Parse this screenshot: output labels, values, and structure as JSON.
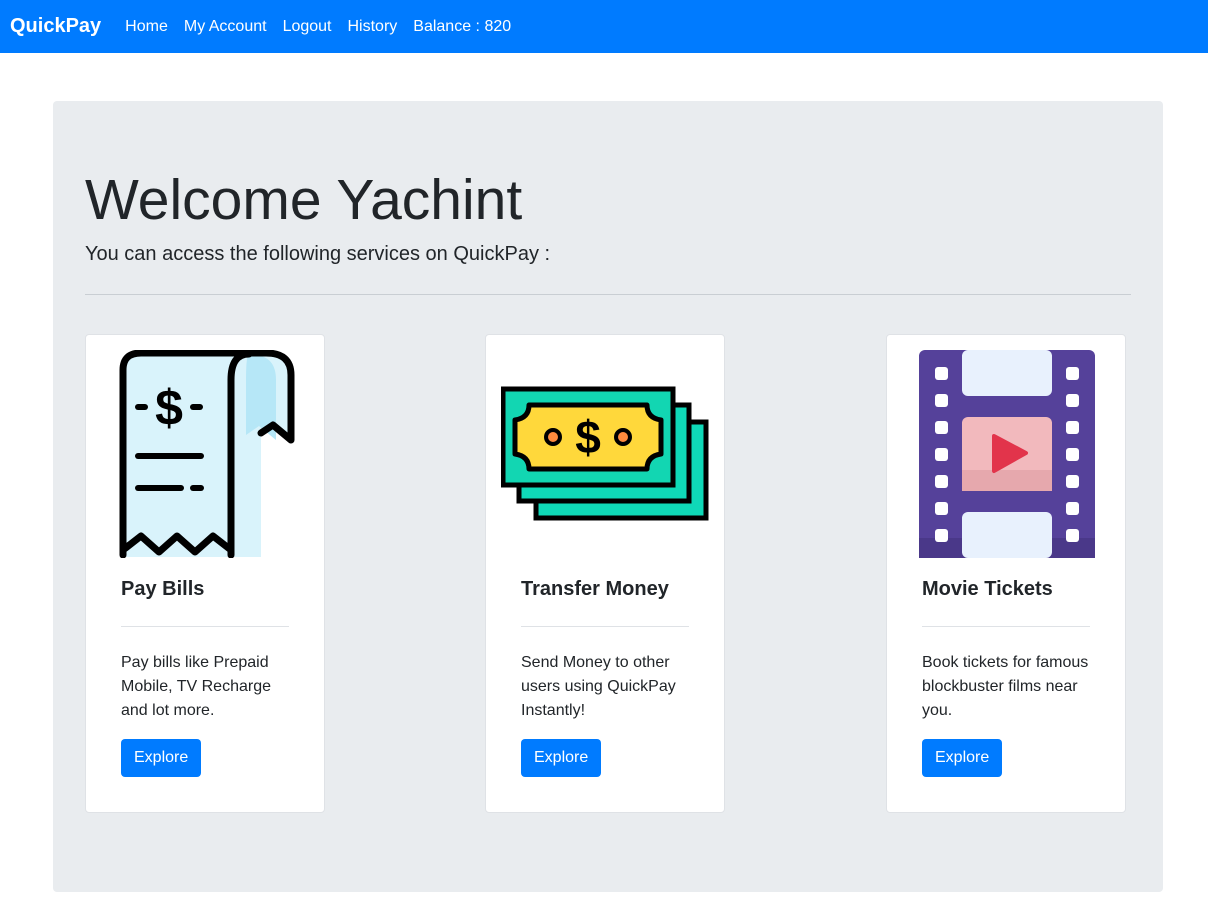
{
  "navbar": {
    "brand": "QuickPay",
    "links": [
      "Home",
      "My Account",
      "Logout",
      "History",
      "Balance : 820"
    ]
  },
  "main": {
    "title": "Welcome Yachint",
    "subtitle": "You can access the following services on QuickPay :",
    "cards": [
      {
        "title": "Pay Bills",
        "text": "Pay bills like Prepaid Mobile, TV Recharge and lot more.",
        "button": "Explore",
        "icon": "receipt-icon"
      },
      {
        "title": "Transfer Money",
        "text": "Send Money to other users using QuickPay Instantly!",
        "button": "Explore",
        "icon": "money-icon"
      },
      {
        "title": "Movie Tickets",
        "text": "Book tickets for famous blockbuster films near you.",
        "button": "Explore",
        "icon": "film-icon"
      }
    ]
  },
  "colors": {
    "primary": "#007bff",
    "jumbotron": "#e9ecef"
  }
}
